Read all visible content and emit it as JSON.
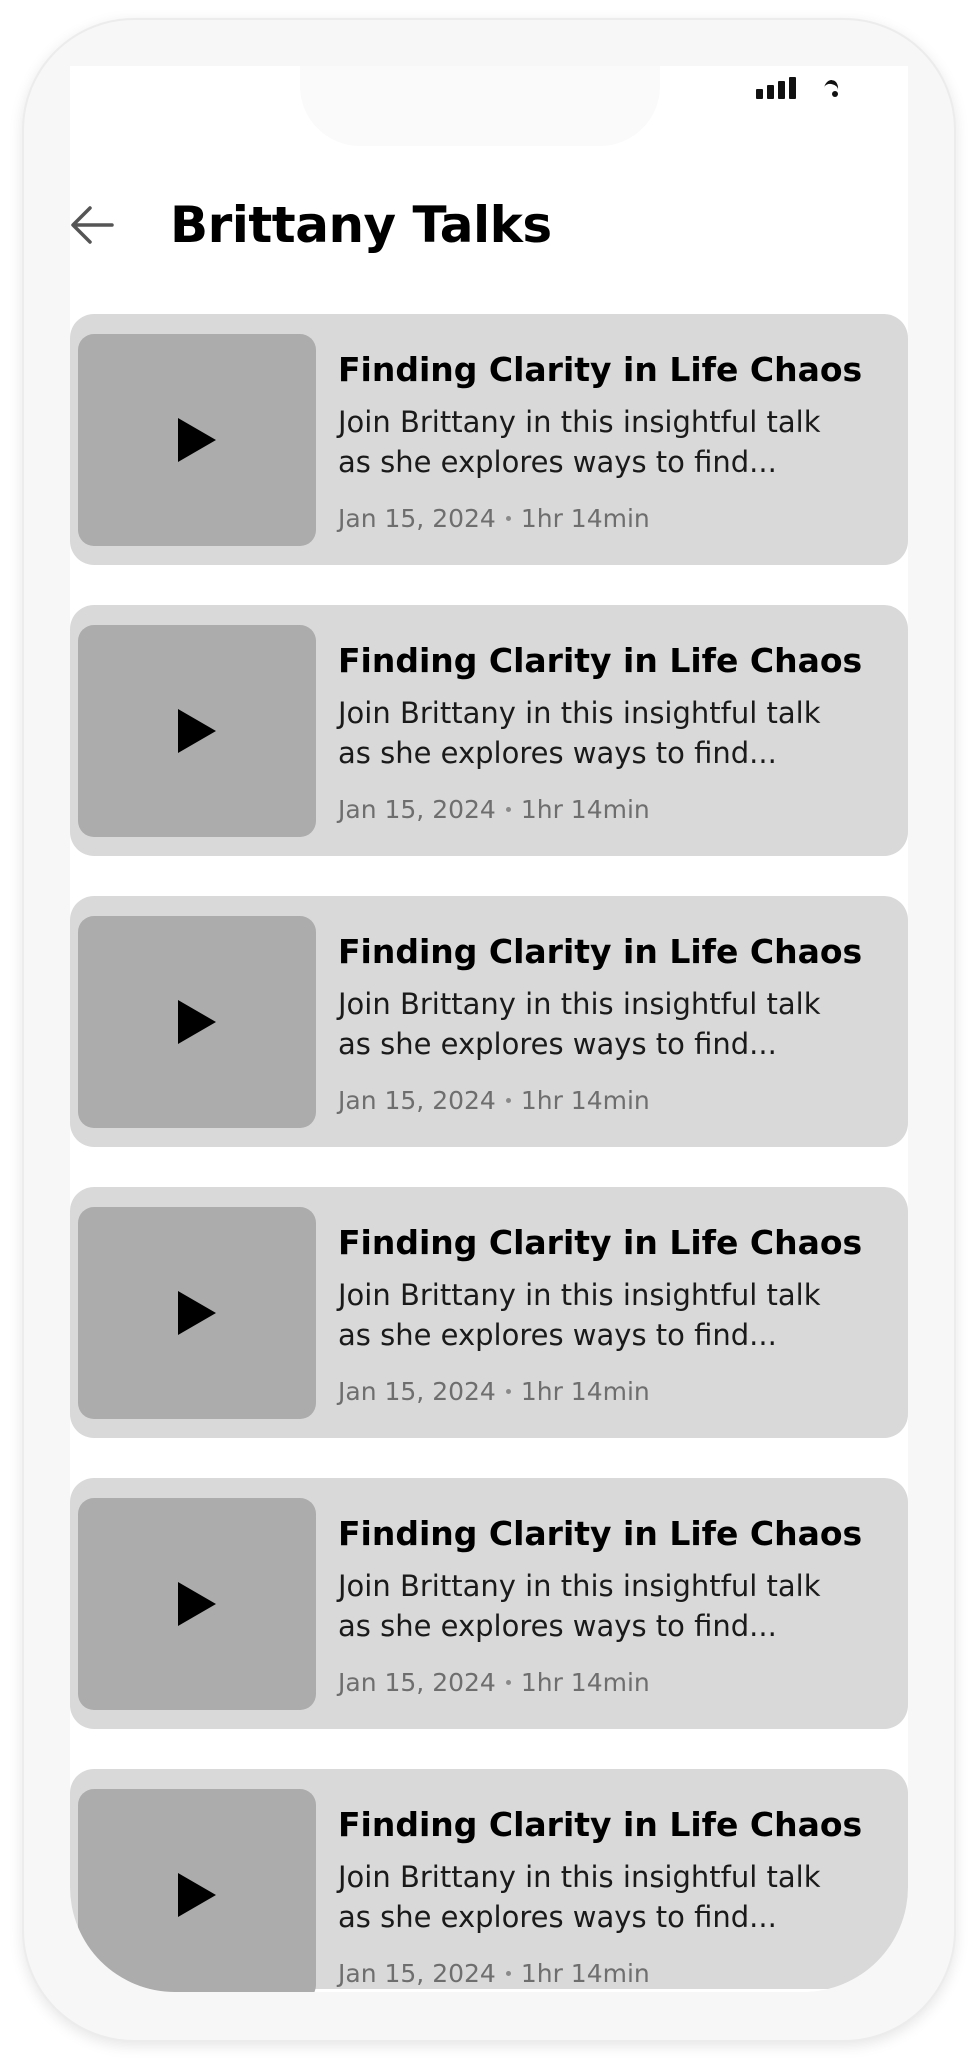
{
  "status_bar": {
    "signal_icon": "cellular-signal-icon",
    "wifi_icon": "wifi-icon"
  },
  "header": {
    "back_icon": "arrow-left-icon",
    "title": "Brittany Talks"
  },
  "talks": [
    {
      "title": "Finding Clarity in Life Chaos",
      "description": "Join Brittany in this insightful talk as she explores  ways to find...",
      "date": "Jan 15, 2024",
      "duration": "1hr 14min"
    },
    {
      "title": "Finding Clarity in Life Chaos",
      "description": "Join Brittany in this insightful talk as she explores  ways to find...",
      "date": "Jan 15, 2024",
      "duration": "1hr 14min"
    },
    {
      "title": "Finding Clarity in Life Chaos",
      "description": "Join Brittany in this insightful talk as she explores  ways to find...",
      "date": "Jan 15, 2024",
      "duration": "1hr 14min"
    },
    {
      "title": "Finding Clarity in Life Chaos",
      "description": "Join Brittany in this insightful talk as she explores  ways to find...",
      "date": "Jan 15, 2024",
      "duration": "1hr 14min"
    },
    {
      "title": "Finding Clarity in Life Chaos",
      "description": "Join Brittany in this insightful talk as she explores  ways to find...",
      "date": "Jan 15, 2024",
      "duration": "1hr 14min"
    },
    {
      "title": "Finding Clarity in Life Chaos",
      "description": "Join Brittany in this insightful talk as she explores  ways to find...",
      "date": "Jan 15, 2024",
      "duration": "1hr 14min"
    }
  ],
  "colors": {
    "card_background": "#d9d9d9",
    "thumbnail_background": "#acacac",
    "meta_text": "#6e6e6e"
  }
}
